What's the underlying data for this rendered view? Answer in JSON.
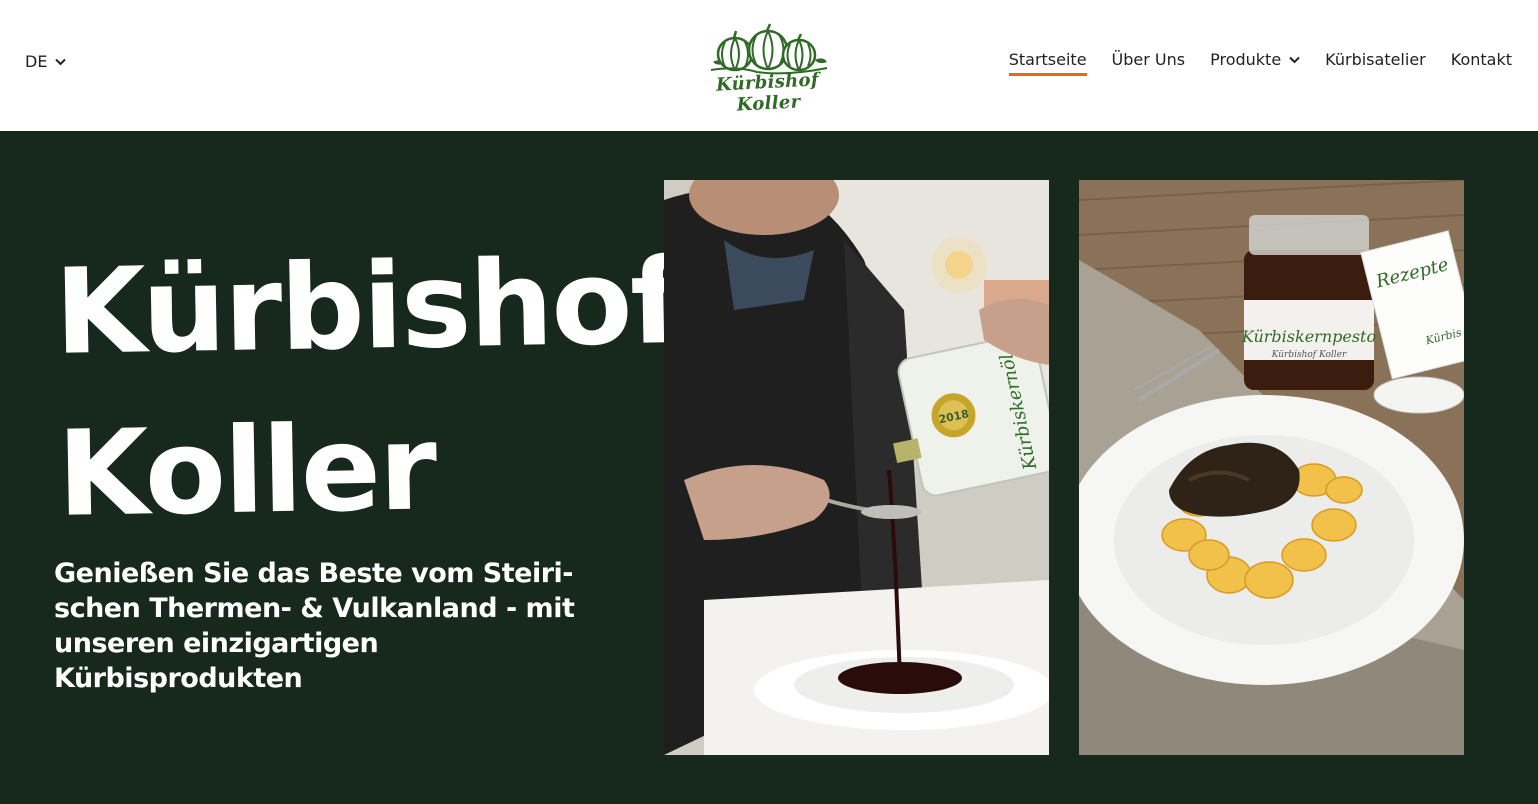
{
  "header": {
    "language": "DE",
    "logo_text": "Kürbishof Koller",
    "nav": [
      {
        "label": "Startseite",
        "active": true
      },
      {
        "label": "Über Uns",
        "active": false
      },
      {
        "label": "Produkte",
        "active": false,
        "dropdown": true
      },
      {
        "label": "Kürbisatelier",
        "active": false
      },
      {
        "label": "Kontakt",
        "active": false
      }
    ]
  },
  "hero": {
    "title_line1": "Kürbishof",
    "title_line2": "Koller",
    "subtitle": "Genießen Sie das Beste vom Steiri-schen Thermen- & Vulkanland - mit unseren einzigartigen Kürbisprodukten",
    "photo1": {
      "can_label": "Kürbiskernöl",
      "medal_text": "2018"
    },
    "photo2": {
      "jar_label": "Kürbiskernpesto",
      "jar_sublabel": "Kürbishof Koller",
      "card_label": "Rezepte",
      "card_sublabel": "Kürbis"
    }
  },
  "colors": {
    "accent": "#e8671a",
    "hero_bg": "#17281c",
    "logo_green": "#2f6a26"
  }
}
